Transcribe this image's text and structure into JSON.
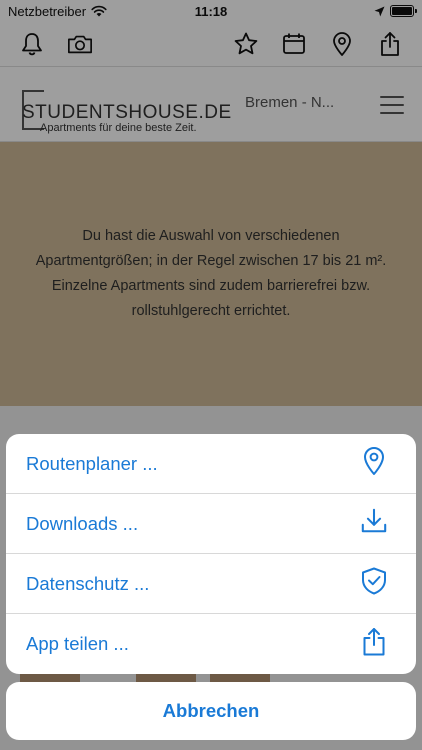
{
  "status_bar": {
    "carrier": "Netzbetreiber",
    "time": "11:18"
  },
  "toolbar": {
    "left_icons": [
      "bell-icon",
      "camera-icon"
    ],
    "right_icons": [
      "star-icon",
      "calendar-icon",
      "map-pin-icon",
      "share-icon"
    ]
  },
  "header": {
    "logo_text": "STUDENTSHOUSE.DE",
    "logo_subtitle": "Apartments für deine beste Zeit.",
    "city": "Bremen - N...",
    "menu_icon": "hamburger-menu-icon"
  },
  "content": {
    "text": "Du hast die Auswahl von verschiedenen Apartmentgrößen; in der Regel zwischen 17 bis 21 m². Einzelne Apartments sind zudem barrierefrei bzw. rollstuhlgerecht errichtet."
  },
  "action_sheet": {
    "items": [
      {
        "label": "Routenplaner ...",
        "icon": "location-pin-icon"
      },
      {
        "label": "Downloads ...",
        "icon": "download-icon"
      },
      {
        "label": "Datenschutz ...",
        "icon": "shield-check-icon"
      },
      {
        "label": "App teilen ...",
        "icon": "share-icon"
      }
    ],
    "cancel_label": "Abbrechen"
  },
  "colors": {
    "accent": "#1a7ad6",
    "beige": "#cdb996",
    "overlay": "rgba(0,0,0,0.38)"
  }
}
